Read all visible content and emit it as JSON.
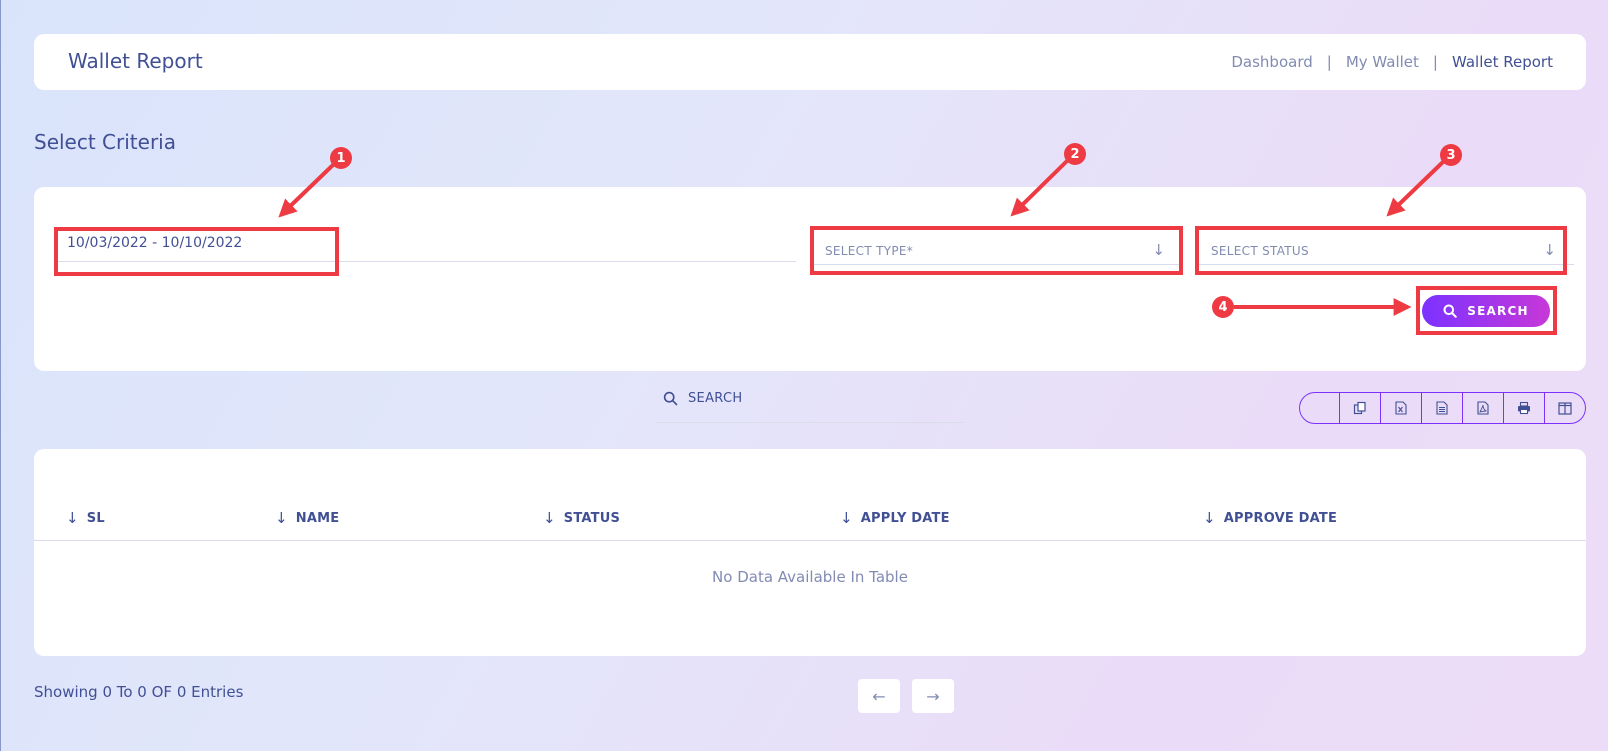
{
  "header": {
    "title": "Wallet Report",
    "breadcrumb": [
      {
        "label": "Dashboard"
      },
      {
        "label": "My Wallet"
      },
      {
        "label": "Wallet Report"
      }
    ],
    "separator": "|"
  },
  "criteria": {
    "title": "Select Criteria",
    "date_range": "10/03/2022 - 10/10/2022",
    "type_placeholder": "SELECT TYPE*",
    "status_placeholder": "SELECT STATUS",
    "search_label": "SEARCH"
  },
  "annotations": [
    "1",
    "2",
    "3",
    "4"
  ],
  "table_toolbar": {
    "search_placeholder": "SEARCH",
    "export_icons": [
      "copy-icon",
      "excel-icon",
      "csv-icon",
      "pdf-icon",
      "print-icon",
      "columns-icon"
    ]
  },
  "table": {
    "columns": [
      "SL",
      "NAME",
      "STATUS",
      "APPLY DATE",
      "APPROVE DATE"
    ],
    "empty_message": "No Data Available In Table"
  },
  "footer": {
    "showing": "Showing 0 To 0 OF 0 Entries"
  },
  "colors": {
    "primary_text": "#415094",
    "muted_text": "#828bb2",
    "accent_start": "#7c32ff",
    "accent_end": "#c738d8",
    "annotation": "#ee3a43"
  }
}
